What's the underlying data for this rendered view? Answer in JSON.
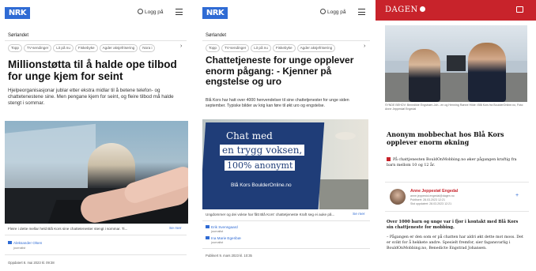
{
  "panel1": {
    "logo": "NRK",
    "login": "Logg på",
    "section": "Sørlandet",
    "tags": [
      "Topp",
      "TV-sendinger",
      "Lit på nu",
      "Fiskebyke",
      "Agder aksjefrisering",
      "Nora i"
    ],
    "headline": "Millionstøtta til å halde ope tilbod for unge kjem for seint",
    "ingress": "Hjelpeorganisasjonar jublar etter ekstra midlar til å betene telefon- og chattetenestene sine. Men pengane kjem for seint, og fleire tilbod må halde stengt i sommar.",
    "caption": "Fleire i dette mellar held Blå Kors sine chattetenester stengt i sommar. Ti...",
    "see_more": "Se mer",
    "author": "Aleksander Olsen",
    "author_role": "journalist",
    "published": "Oppdatert 8. mai 2023 kl. 09:38"
  },
  "panel2": {
    "logo": "NRK",
    "login": "Logg på",
    "section": "Sørlandet",
    "tags": [
      "Topp",
      "TV-sendinger",
      "Lit på nu",
      "Fiskebyke",
      "Agder aksjefrisering",
      "Nora i"
    ],
    "headline": "Chattetjeneste for unge opplever enorm pågang: - Kjenner på engstelse og uro",
    "ingress": "Blå Kors har hatt over 4000 henvendelser til sine chattetjenester for unge siden september. Typiske bilder av krig kan føre til økt uro og engstelse.",
    "banner_lines": [
      "Chat med",
      "en trygg voksen,",
      "100% anonymt"
    ],
    "banner_footer": "Blå Kors BoulderOnline.no",
    "caption": "Ungdommer og dei vokse har fått Blå Kors' chattetjeneste Kraft seg ei auke på...",
    "see_more": "Se mer",
    "authors": [
      "Erik Svensgaard",
      "Ina Marie Egeribæ"
    ],
    "author_role": "journalist",
    "published": "Publisert 9. mars 2023 kl. 10:35"
  },
  "panel3": {
    "logo": "DAGEN",
    "photo_caption": "SYNDE BEHOV: Benedikte Engstrøm-Joh...en og Henning Rønne Hilde i Blå Kors fra BoulderOnline.no, Foto: Anne Jeppestøl Engedal",
    "headline": "Anonym mobbechat hos Blå Kors opplever enorm økning",
    "related": "På chattjenesten BouldOnMobbing.no øker pågangen kraftig fra barn mellom 10 og 12 år.",
    "author_name": "Anne Jeppestøl Engedal",
    "author_meta": [
      "anne.jeppestol.engedal@dagen.no",
      "Publisert: 28.03.2023 12:21",
      "Sist oppdatert: 28.03.2023 12:21"
    ],
    "plus": "+",
    "body_lead": "Over 1000 barn og unge var i fjor i kontakt med Blå Kors sin chattjeneste for mobbing.",
    "body_text": "– Pågangen er den som er på chatten har aldri økt dette mot moss. Det er svikt for å hekkete andre. Spesielt fremfor, sier fagansvarlig i BouldOnMobbing.no, Benedicte Engstrad Johansen."
  },
  "colors": {
    "nrk_blue": "#2f6bd4",
    "dagen_red": "#c8232b",
    "banner_blue": "#1f3d78"
  }
}
